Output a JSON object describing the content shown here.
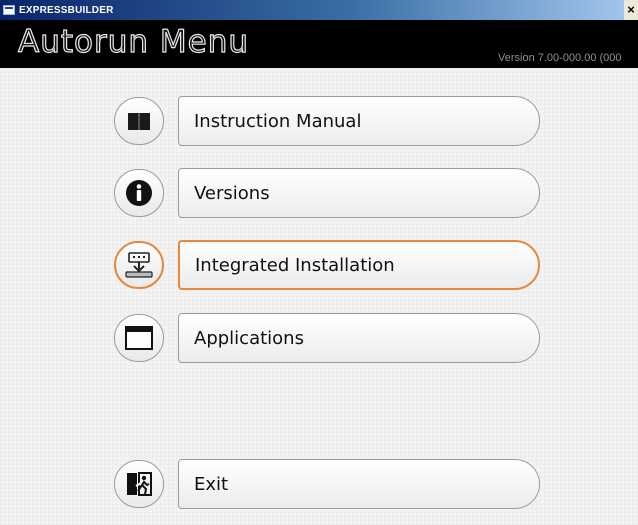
{
  "window": {
    "title": "EXPRESSBUILDER",
    "close_glyph": "×"
  },
  "header": {
    "title": "Autorun Menu",
    "version": "Version 7.00-000.00 (000"
  },
  "menu": {
    "items": [
      {
        "label": "Instruction Manual",
        "icon": "book-icon",
        "active": false
      },
      {
        "label": "Versions",
        "icon": "info-icon",
        "active": false
      },
      {
        "label": "Integrated Installation",
        "icon": "install-icon",
        "active": true
      },
      {
        "label": "Applications",
        "icon": "window-icon",
        "active": false
      }
    ],
    "exit": {
      "label": "Exit",
      "icon": "exit-icon"
    }
  },
  "colors": {
    "highlight_border": "#e8873a",
    "header_background": "#000000",
    "titlebar_start": "#0a246a"
  }
}
